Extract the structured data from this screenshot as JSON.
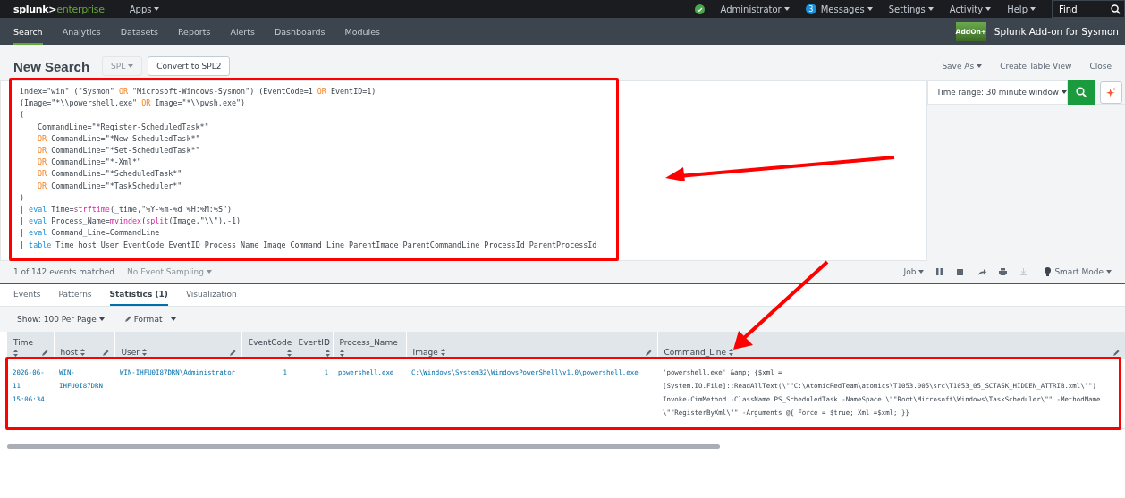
{
  "top_bar": {
    "logo": {
      "brand": "splunk>",
      "product": "enterprise"
    },
    "apps_menu": "Apps",
    "menus": [
      {
        "label": "Administrator"
      },
      {
        "label": "Messages",
        "badge": "3"
      },
      {
        "label": "Settings"
      },
      {
        "label": "Activity"
      },
      {
        "label": "Help"
      }
    ],
    "find": {
      "placeholder": "Find"
    }
  },
  "nav": {
    "tabs": [
      {
        "label": "Search",
        "selected": true
      },
      {
        "label": "Analytics",
        "selected": false
      },
      {
        "label": "Datasets",
        "selected": false
      },
      {
        "label": "Reports",
        "selected": false
      },
      {
        "label": "Alerts",
        "selected": false
      },
      {
        "label": "Dashboards",
        "selected": false
      },
      {
        "label": "Modules",
        "selected": false
      }
    ],
    "app_icon_text": "AddOn+",
    "app_title": "Splunk Add-on for Sysmon"
  },
  "page": {
    "title": "New Search",
    "spl_dropdown": {
      "label": "SPL",
      "disabled": true
    },
    "convert_button": "Convert to SPL2",
    "actions": [
      "Save As",
      "Create Table View",
      "Close"
    ]
  },
  "search": {
    "query_lines": [
      {
        "indented": false,
        "tokens": [
          {
            "kind": "text",
            "text": "index=\"win\" (\"Sysmon\" "
          },
          {
            "kind": "operator",
            "text": "OR"
          },
          {
            "kind": "text",
            "text": " \"Microsoft-Windows-Sysmon\") (EventCode=1 "
          },
          {
            "kind": "operator",
            "text": "OR"
          },
          {
            "kind": "text",
            "text": " EventID=1)"
          }
        ]
      },
      {
        "indented": false,
        "tokens": [
          {
            "kind": "text",
            "text": "(Image=\"*\\\\powershell.exe\" "
          },
          {
            "kind": "operator",
            "text": "OR"
          },
          {
            "kind": "text",
            "text": " Image=\"*\\\\pwsh.exe\")"
          }
        ]
      },
      {
        "indented": false,
        "tokens": [
          {
            "kind": "text",
            "text": "("
          }
        ]
      },
      {
        "indented": true,
        "tokens": [
          {
            "kind": "text",
            "text": "CommandLine=\"*Register-ScheduledTask*\""
          }
        ]
      },
      {
        "indented": true,
        "tokens": [
          {
            "kind": "operator",
            "text": "OR"
          },
          {
            "kind": "text",
            "text": " CommandLine=\"*New-ScheduledTask*\""
          }
        ]
      },
      {
        "indented": true,
        "tokens": [
          {
            "kind": "operator",
            "text": "OR"
          },
          {
            "kind": "text",
            "text": " CommandLine=\"*Set-ScheduledTask*\""
          }
        ]
      },
      {
        "indented": true,
        "tokens": [
          {
            "kind": "operator",
            "text": "OR"
          },
          {
            "kind": "text",
            "text": " CommandLine=\"*-Xml*\""
          }
        ]
      },
      {
        "indented": true,
        "tokens": [
          {
            "kind": "operator",
            "text": "OR"
          },
          {
            "kind": "text",
            "text": " CommandLine=\"*ScheduledTask*\""
          }
        ]
      },
      {
        "indented": true,
        "tokens": [
          {
            "kind": "operator",
            "text": "OR"
          },
          {
            "kind": "text",
            "text": " CommandLine=\"*TaskScheduler*\""
          }
        ]
      },
      {
        "indented": false,
        "tokens": [
          {
            "kind": "text",
            "text": ")"
          }
        ]
      },
      {
        "indented": false,
        "tokens": [
          {
            "kind": "text",
            "text": "| "
          },
          {
            "kind": "command",
            "text": "eval"
          },
          {
            "kind": "text",
            "text": " Time="
          },
          {
            "kind": "function",
            "text": "strftime"
          },
          {
            "kind": "text",
            "text": "(_time,\"%Y-%m-%d %H:%M:%S\")"
          }
        ]
      },
      {
        "indented": false,
        "tokens": [
          {
            "kind": "text",
            "text": "| "
          },
          {
            "kind": "command",
            "text": "eval"
          },
          {
            "kind": "text",
            "text": " Process_Name="
          },
          {
            "kind": "function",
            "text": "mvindex"
          },
          {
            "kind": "text",
            "text": "("
          },
          {
            "kind": "function",
            "text": "split"
          },
          {
            "kind": "text",
            "text": "(Image,\"\\\\\"),-1)"
          }
        ]
      },
      {
        "indented": false,
        "tokens": [
          {
            "kind": "text",
            "text": "| "
          },
          {
            "kind": "command",
            "text": "eval"
          },
          {
            "kind": "text",
            "text": " Command_Line=CommandLine"
          }
        ]
      },
      {
        "indented": false,
        "tokens": [
          {
            "kind": "text",
            "text": "| "
          },
          {
            "kind": "command",
            "text": "table"
          },
          {
            "kind": "text",
            "text": " Time host User EventCode EventID Process_Name Image Command_Line ParentImage ParentCommandLine ProcessId ParentProcessId"
          }
        ]
      }
    ],
    "time_range": "Time range: 30 minute window"
  },
  "status": {
    "matched": "1 of 142 events matched",
    "sampling": {
      "label": "No Event Sampling",
      "disabled": true
    },
    "job": "Job",
    "mode": "Smart Mode"
  },
  "result_tabs": [
    {
      "label": "Events",
      "selected": false
    },
    {
      "label": "Patterns",
      "selected": false
    },
    {
      "label": "Statistics (1)",
      "selected": true
    },
    {
      "label": "Visualization",
      "selected": false
    }
  ],
  "results_toolbar": {
    "page_size": "Show: 100 Per Page",
    "format": "Format"
  },
  "table": {
    "columns": [
      {
        "label": "Time",
        "numeric": false
      },
      {
        "label": "host",
        "numeric": false
      },
      {
        "label": "User",
        "numeric": false
      },
      {
        "label": "EventCode",
        "numeric": true
      },
      {
        "label": "EventID",
        "numeric": true
      },
      {
        "label": "Process_Name",
        "numeric": false
      },
      {
        "label": "Image",
        "numeric": false
      },
      {
        "label": "Command_Line",
        "numeric": false
      }
    ],
    "rows": [
      {
        "cells": [
          "2026-06-11 15:06:34",
          "WIN-IHFU0I87DRN",
          "WIN-IHFU0I87DRN\\Administrator",
          "1",
          "1",
          "powershell.exe",
          "C:\\Windows\\System32\\WindowsPowerShell\\v1.0\\powershell.exe",
          "'powershell.exe' &amp; {$xml = [System.IO.File]::ReadAllText(\\\"\"C:\\AtomicRedTeam\\atomics\\T1053.005\\src\\T1053_05_SCTASK_HIDDEN_ATTRIB.xml\\\"\") Invoke-CimMethod -ClassName PS_ScheduledTask -NameSpace \\\"\"Root\\Microsoft\\Windows\\TaskScheduler\\\"\" -MethodName \\\"\"RegisterByXml\\\"\" -Arguments @{ Force = $true; Xml =$xml; }}"
        ]
      }
    ]
  }
}
